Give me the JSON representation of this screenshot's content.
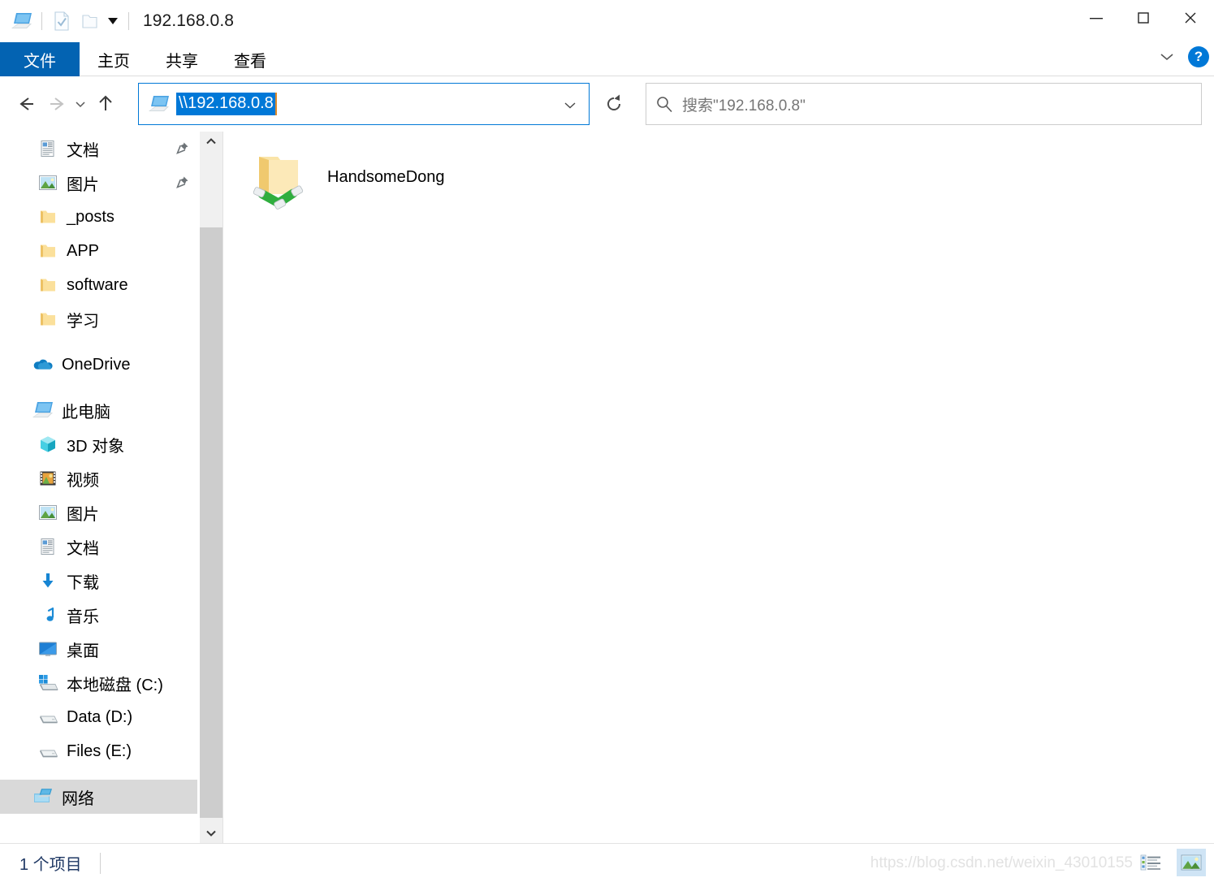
{
  "window": {
    "title": "192.168.0.8",
    "quick_access": [
      {
        "name": "computer-icon",
        "label": "此电脑"
      },
      {
        "name": "properties-icon",
        "label": "属性"
      },
      {
        "name": "new-folder-icon",
        "label": "新建文件夹"
      }
    ],
    "controls": {
      "minimize": "—",
      "maximize": "▢",
      "close": "✕"
    }
  },
  "ribbon": {
    "tabs": [
      {
        "label": "文件",
        "active": true
      },
      {
        "label": "主页",
        "active": false
      },
      {
        "label": "共享",
        "active": false
      },
      {
        "label": "查看",
        "active": false
      }
    ],
    "help_label": "?"
  },
  "navigation": {
    "back_label": "后退",
    "forward_label": "前进",
    "recent_label": "最近浏览的位置",
    "up_label": "上移到",
    "refresh_label": "刷新"
  },
  "address": {
    "value": "\\\\192.168.0.8",
    "icon": "computer-icon"
  },
  "search": {
    "placeholder": "搜索\"192.168.0.8\""
  },
  "sidebar": {
    "items": [
      {
        "label": "文档",
        "icon": "document-icon",
        "indent": "lvl1",
        "pinned": true,
        "selected": false
      },
      {
        "label": "图片",
        "icon": "pictures-icon",
        "indent": "lvl1",
        "pinned": true,
        "selected": false
      },
      {
        "label": "_posts",
        "icon": "folder-icon",
        "indent": "lvl1",
        "pinned": false,
        "selected": false
      },
      {
        "label": "APP",
        "icon": "folder-icon",
        "indent": "lvl1",
        "pinned": false,
        "selected": false
      },
      {
        "label": "software",
        "icon": "folder-icon",
        "indent": "lvl1",
        "pinned": false,
        "selected": false
      },
      {
        "label": "学习",
        "icon": "folder-icon",
        "indent": "lvl1",
        "pinned": false,
        "selected": false
      },
      {
        "label": "OneDrive",
        "icon": "onedrive-icon",
        "indent": "lvl-root",
        "pinned": false,
        "selected": false,
        "spacer_before": true
      },
      {
        "label": "此电脑",
        "icon": "computer-icon",
        "indent": "lvl-root",
        "pinned": false,
        "selected": false,
        "spacer_before": true
      },
      {
        "label": "3D 对象",
        "icon": "3d-objects-icon",
        "indent": "lvl1",
        "pinned": false,
        "selected": false
      },
      {
        "label": "视频",
        "icon": "videos-icon",
        "indent": "lvl1",
        "pinned": false,
        "selected": false
      },
      {
        "label": "图片",
        "icon": "pictures-icon",
        "indent": "lvl1",
        "pinned": false,
        "selected": false
      },
      {
        "label": "文档",
        "icon": "document-icon",
        "indent": "lvl1",
        "pinned": false,
        "selected": false
      },
      {
        "label": "下载",
        "icon": "downloads-icon",
        "indent": "lvl1",
        "pinned": false,
        "selected": false
      },
      {
        "label": "音乐",
        "icon": "music-icon",
        "indent": "lvl1",
        "pinned": false,
        "selected": false
      },
      {
        "label": "桌面",
        "icon": "desktop-icon",
        "indent": "lvl1",
        "pinned": false,
        "selected": false
      },
      {
        "label": "本地磁盘 (C:)",
        "icon": "system-drive-icon",
        "indent": "lvl1",
        "pinned": false,
        "selected": false
      },
      {
        "label": "Data (D:)",
        "icon": "drive-icon",
        "indent": "lvl1",
        "pinned": false,
        "selected": false
      },
      {
        "label": "Files (E:)",
        "icon": "drive-icon",
        "indent": "lvl1",
        "pinned": false,
        "selected": false
      },
      {
        "label": "网络",
        "icon": "network-icon",
        "indent": "lvl-root",
        "pinned": false,
        "selected": true,
        "spacer_before": true
      }
    ]
  },
  "content": {
    "items": [
      {
        "name": "HandsomeDong",
        "icon": "shared-folder-icon"
      }
    ]
  },
  "statusbar": {
    "count_text": "1 个项目",
    "views": [
      {
        "name": "details-view-button",
        "label": "详细信息",
        "active": false
      },
      {
        "name": "large-icons-view-button",
        "label": "大图标",
        "active": true
      }
    ]
  },
  "watermark": {
    "text": "https://blog.csdn.net/weixin_43010155"
  },
  "colors": {
    "accent": "#0078d7",
    "file_tab": "#0363b2",
    "selection": "#d9d9d9",
    "status_text": "#1f3864"
  }
}
